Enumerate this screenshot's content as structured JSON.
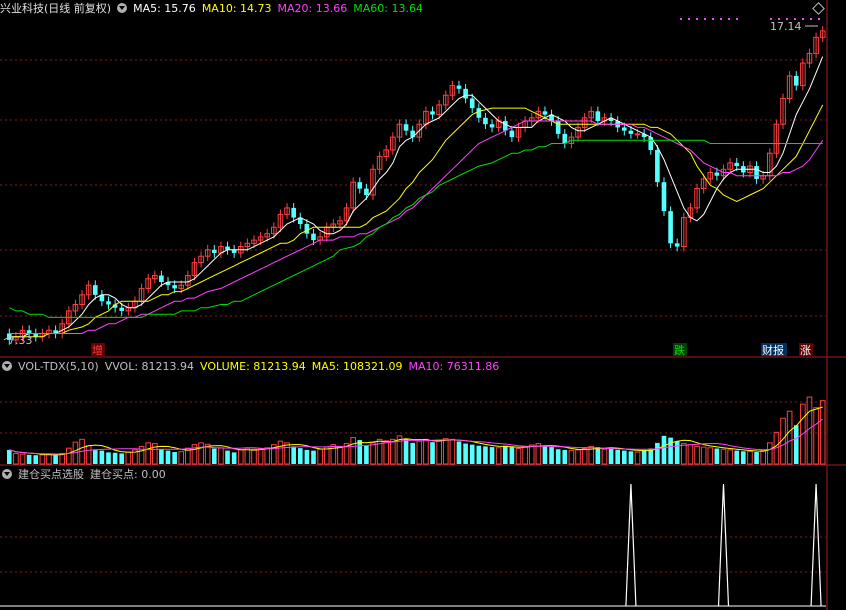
{
  "main_header": {
    "title": "兴业科技(日线 前复权)",
    "ma5": "MA5: 15.76",
    "ma10": "MA10: 14.73",
    "ma20": "MA20: 13.66",
    "ma60": "MA60: 13.64"
  },
  "vol_header": {
    "name": "VOL-TDX(5,10)",
    "vvol": "VVOL: 81213.94",
    "volume": "VOLUME: 81213.94",
    "ma5": "MA5: 108321.09",
    "ma10": "MA10: 76311.86"
  },
  "ind_header": {
    "name": "建仓买点选股",
    "value": "建仓买点: 0.00"
  },
  "annotations": {
    "high": "17.14",
    "low": "7.33",
    "tag_zeng": "增",
    "tag_die": "跌",
    "tag_caibao": "财报",
    "tag_zhang": "涨"
  },
  "colors": {
    "up": "#ff4040",
    "down": "#54ffff",
    "ma5": "#ffffff",
    "ma10": "#ffff00",
    "ma20": "#ff40ff",
    "ma60": "#00e000",
    "grid": "#8b1a1a"
  },
  "chart_data": [
    {
      "type": "candlestick",
      "title": "兴业科技(日线 前复权)",
      "ylim": [
        7.0,
        17.5
      ],
      "x": [
        "1",
        "2",
        "3",
        "4",
        "5",
        "6",
        "7",
        "8",
        "9",
        "10",
        "11",
        "12",
        "13",
        "14",
        "15",
        "16",
        "17",
        "18",
        "19",
        "20",
        "21",
        "22",
        "23",
        "24",
        "25",
        "26",
        "27",
        "28",
        "29",
        "30",
        "31",
        "32",
        "33",
        "34",
        "35",
        "36",
        "37",
        "38",
        "39",
        "40",
        "41",
        "42",
        "43",
        "44",
        "45",
        "46",
        "47",
        "48",
        "49",
        "50",
        "51",
        "52",
        "53",
        "54",
        "55",
        "56",
        "57",
        "58",
        "59",
        "60",
        "61",
        "62",
        "63",
        "64",
        "65",
        "66",
        "67",
        "68",
        "69",
        "70",
        "71",
        "72",
        "73",
        "74",
        "75",
        "76",
        "77",
        "78",
        "79",
        "80",
        "81",
        "82",
        "83",
        "84",
        "85",
        "86",
        "87",
        "88",
        "89",
        "90",
        "91",
        "92",
        "93",
        "94",
        "95",
        "96",
        "97",
        "98",
        "99",
        "100",
        "101",
        "102",
        "103",
        "104",
        "105",
        "106",
        "107",
        "108",
        "109",
        "110",
        "111",
        "112",
        "113",
        "114",
        "115",
        "116",
        "117",
        "118",
        "119",
        "120",
        "121",
        "122",
        "123",
        "124",
        "125",
        "126",
        "127",
        "128",
        "129",
        "130",
        "131",
        "132",
        "133",
        "134",
        "135",
        "136",
        "137",
        "138",
        "139",
        "140",
        "141",
        "142",
        "143",
        "144",
        "145",
        "146",
        "147",
        "148",
        "149",
        "150",
        "151",
        "152",
        "153",
        "154",
        "155",
        "156",
        "157",
        "158",
        "159",
        "160",
        "161",
        "162",
        "163",
        "164"
      ],
      "open": [
        7.7,
        7.5,
        7.6,
        7.8,
        7.7,
        7.6,
        7.7,
        7.8,
        7.7,
        8.0,
        8.4,
        8.6,
        8.9,
        9.2,
        8.9,
        8.7,
        8.6,
        8.5,
        8.4,
        8.5,
        8.7,
        9.1,
        9.4,
        9.5,
        9.3,
        9.2,
        9.1,
        9.2,
        9.5,
        9.9,
        10.1,
        10.3,
        10.2,
        10.4,
        10.3,
        10.2,
        10.4,
        10.5,
        10.6,
        10.7,
        10.8,
        11.0,
        11.4,
        11.6,
        11.3,
        11.1,
        10.8,
        10.6,
        10.7,
        11.0,
        11.1,
        11.2,
        11.6,
        12.4,
        12.2,
        12.0,
        12.8,
        13.2,
        13.4,
        13.8,
        14.2,
        14.0,
        13.8,
        14.2,
        14.6,
        14.5,
        14.8,
        15.1,
        15.4,
        15.3,
        15.0,
        14.7,
        14.4,
        14.2,
        14.1,
        14.3,
        14.0,
        13.8,
        14.1,
        14.3,
        14.4,
        14.6,
        14.5,
        14.3,
        13.9,
        13.6,
        13.8,
        14.1,
        14.4,
        14.6,
        14.3,
        14.4,
        14.3,
        14.1,
        14.0,
        13.9,
        13.9,
        13.8,
        13.4,
        12.4,
        11.5,
        10.5,
        10.4,
        11.3,
        11.6,
        12.2,
        12.5,
        12.7,
        12.6,
        12.8,
        13.0,
        12.9,
        12.7,
        12.9,
        12.5,
        12.6,
        13.3,
        14.2,
        15.0,
        15.7,
        15.4,
        16.1,
        16.4,
        16.9
      ],
      "close": [
        7.5,
        7.6,
        7.8,
        7.7,
        7.6,
        7.7,
        7.8,
        7.7,
        8.0,
        8.4,
        8.6,
        8.9,
        9.2,
        8.9,
        8.7,
        8.6,
        8.5,
        8.4,
        8.5,
        8.7,
        9.1,
        9.4,
        9.5,
        9.3,
        9.2,
        9.1,
        9.2,
        9.5,
        9.9,
        10.1,
        10.3,
        10.2,
        10.4,
        10.3,
        10.2,
        10.4,
        10.5,
        10.6,
        10.7,
        10.8,
        11.0,
        11.4,
        11.6,
        11.3,
        11.1,
        10.8,
        10.6,
        10.7,
        11.0,
        11.1,
        11.2,
        11.6,
        12.4,
        12.2,
        12.0,
        12.8,
        13.2,
        13.4,
        13.8,
        14.2,
        14.0,
        13.8,
        14.2,
        14.6,
        14.5,
        14.8,
        15.1,
        15.4,
        15.3,
        15.0,
        14.7,
        14.4,
        14.2,
        14.1,
        14.3,
        14.0,
        13.8,
        14.1,
        14.3,
        14.4,
        14.6,
        14.5,
        14.3,
        13.9,
        13.6,
        13.8,
        14.1,
        14.4,
        14.6,
        14.3,
        14.4,
        14.3,
        14.1,
        14.0,
        13.9,
        13.9,
        13.8,
        13.4,
        12.4,
        11.5,
        10.5,
        10.4,
        11.3,
        11.6,
        12.2,
        12.5,
        12.7,
        12.6,
        12.8,
        13.0,
        12.9,
        12.7,
        12.9,
        12.5,
        12.6,
        13.3,
        14.2,
        15.0,
        15.7,
        15.4,
        16.1,
        16.4,
        16.9,
        17.1
      ],
      "ma_series": [
        {
          "name": "MA5",
          "values": [
            7.6,
            7.6,
            7.6,
            7.7,
            7.7,
            7.7,
            7.7,
            7.7,
            7.8,
            7.9,
            8.1,
            8.3,
            8.6,
            8.8,
            8.9,
            8.9,
            8.8,
            8.6,
            8.5,
            8.5,
            8.6,
            8.8,
            9.0,
            9.2,
            9.3,
            9.3,
            9.3,
            9.3,
            9.4,
            9.6,
            9.8,
            10.0,
            10.2,
            10.3,
            10.3,
            10.3,
            10.3,
            10.4,
            10.5,
            10.6,
            10.7,
            10.9,
            11.1,
            11.2,
            11.3,
            11.2,
            11.1,
            10.9,
            10.8,
            10.8,
            10.9,
            11.1,
            11.5,
            11.7,
            11.9,
            12.2,
            12.5,
            12.7,
            13.0,
            13.5,
            13.7,
            13.8,
            14.0,
            14.2,
            14.3,
            14.4,
            14.6,
            14.8,
            15.0,
            15.1,
            15.1,
            14.9,
            14.7,
            14.5,
            14.3,
            14.2,
            14.1,
            14.1,
            14.1,
            14.1,
            14.3,
            14.4,
            14.5,
            14.4,
            14.3,
            14.1,
            14.0,
            14.0,
            14.1,
            14.2,
            14.3,
            14.4,
            14.3,
            14.2,
            14.1,
            14.0,
            13.9,
            13.8,
            13.5,
            13.1,
            12.6,
            12.1,
            11.6,
            11.3,
            11.2,
            11.4,
            11.8,
            12.2,
            12.5,
            12.7,
            12.8,
            12.8,
            12.8,
            12.8,
            12.7,
            12.7,
            12.9,
            13.3,
            13.9,
            14.5,
            14.9,
            15.3,
            15.8,
            16.3
          ]
        },
        {
          "name": "MA10",
          "values": [
            7.6,
            7.6,
            7.6,
            7.6,
            7.6,
            7.6,
            7.7,
            7.7,
            7.7,
            7.8,
            7.9,
            8.0,
            8.2,
            8.3,
            8.4,
            8.6,
            8.7,
            8.7,
            8.7,
            8.7,
            8.7,
            8.8,
            8.9,
            8.9,
            9.0,
            9.0,
            9.1,
            9.2,
            9.3,
            9.4,
            9.6,
            9.7,
            9.8,
            9.9,
            10.0,
            10.1,
            10.2,
            10.3,
            10.4,
            10.5,
            10.5,
            10.6,
            10.8,
            10.9,
            11.0,
            11.0,
            11.0,
            11.0,
            11.0,
            11.0,
            11.0,
            11.1,
            11.3,
            11.4,
            11.5,
            11.7,
            11.9,
            12.2,
            12.4,
            12.7,
            12.9,
            13.1,
            13.4,
            13.7,
            13.9,
            14.1,
            14.3,
            14.5,
            14.6,
            14.7,
            14.7,
            14.7,
            14.7,
            14.7,
            14.7,
            14.6,
            14.5,
            14.4,
            14.3,
            14.2,
            14.2,
            14.2,
            14.2,
            14.2,
            14.2,
            14.2,
            14.2,
            14.2,
            14.2,
            14.2,
            14.2,
            14.2,
            14.1,
            14.1,
            14.0,
            13.9,
            13.7,
            13.5,
            13.3,
            12.9,
            12.6,
            12.3,
            12.2,
            12.0,
            11.9,
            11.8,
            11.9,
            12.0,
            12.2,
            12.4,
            12.6,
            12.8,
            13.0,
            13.2,
            13.6,
            14.0,
            14.4,
            14.8
          ]
        },
        {
          "name": "MA20",
          "values": [
            7.7,
            7.7,
            7.7,
            7.7,
            7.7,
            7.7,
            7.7,
            7.7,
            7.7,
            7.7,
            7.7,
            7.8,
            7.8,
            7.9,
            8.0,
            8.0,
            8.1,
            8.2,
            8.2,
            8.3,
            8.3,
            8.4,
            8.5,
            8.6,
            8.7,
            8.7,
            8.8,
            8.8,
            8.9,
            9.0,
            9.1,
            9.2,
            9.3,
            9.4,
            9.5,
            9.6,
            9.7,
            9.8,
            9.9,
            10.0,
            10.1,
            10.2,
            10.3,
            10.4,
            10.5,
            10.6,
            10.6,
            10.6,
            10.7,
            10.7,
            10.8,
            10.8,
            10.9,
            11.0,
            11.1,
            11.2,
            11.3,
            11.5,
            11.6,
            11.8,
            12.0,
            12.2,
            12.4,
            12.6,
            12.8,
            13.0,
            13.2,
            13.4,
            13.6,
            13.8,
            13.9,
            14.0,
            14.1,
            14.2,
            14.3,
            14.3,
            14.3,
            14.3,
            14.3,
            14.3,
            14.3,
            14.3,
            14.3,
            14.3,
            14.3,
            14.2,
            14.2,
            14.2,
            14.2,
            14.2,
            14.1,
            14.1,
            14.0,
            13.9,
            13.8,
            13.7,
            13.6,
            13.5,
            13.4,
            13.2,
            13.0,
            12.9,
            12.8,
            12.7,
            12.7,
            12.6,
            12.6,
            12.6,
            12.6,
            12.6,
            12.6,
            12.7,
            12.7,
            12.8,
            12.9,
            13.1,
            13.4,
            13.7
          ]
        },
        {
          "name": "MA60",
          "values": [
            8.5,
            8.4,
            8.4,
            8.3,
            8.3,
            8.3,
            8.2,
            8.2,
            8.2,
            8.2,
            8.2,
            8.2,
            8.2,
            8.2,
            8.2,
            8.2,
            8.2,
            8.2,
            8.2,
            8.2,
            8.3,
            8.3,
            8.3,
            8.3,
            8.3,
            8.4,
            8.4,
            8.4,
            8.5,
            8.5,
            8.6,
            8.6,
            8.7,
            8.7,
            8.8,
            8.9,
            9.0,
            9.1,
            9.2,
            9.3,
            9.4,
            9.5,
            9.6,
            9.7,
            9.8,
            9.9,
            10.0,
            10.1,
            10.3,
            10.4,
            10.5,
            10.7,
            10.8,
            11.0,
            11.1,
            11.3,
            11.4,
            11.6,
            11.7,
            11.9,
            12.0,
            12.1,
            12.3,
            12.4,
            12.5,
            12.6,
            12.7,
            12.8,
            12.9,
            13.0,
            13.1,
            13.2,
            13.3,
            13.3,
            13.4,
            13.4,
            13.5,
            13.5,
            13.6,
            13.6,
            13.6,
            13.7,
            13.7,
            13.7,
            13.7,
            13.7,
            13.7,
            13.7,
            13.7,
            13.7,
            13.7,
            13.7,
            13.7,
            13.7,
            13.7,
            13.7,
            13.7,
            13.7,
            13.7,
            13.7,
            13.7,
            13.6,
            13.6,
            13.6,
            13.6,
            13.6,
            13.6,
            13.6,
            13.6,
            13.6,
            13.6,
            13.6,
            13.6,
            13.6,
            13.6,
            13.6,
            13.6,
            13.6
          ]
        }
      ]
    },
    {
      "type": "bar",
      "title": "VOL-TDX(5,10)",
      "ylim": [
        0,
        250000
      ],
      "values": [
        40000,
        30000,
        28000,
        26000,
        25000,
        26000,
        27000,
        25000,
        30000,
        45000,
        62000,
        70000,
        52000,
        40000,
        38000,
        33000,
        32000,
        30000,
        34000,
        40000,
        50000,
        60000,
        58000,
        42000,
        38000,
        34000,
        35000,
        45000,
        55000,
        60000,
        56000,
        44000,
        46000,
        38000,
        33000,
        40000,
        45000,
        42000,
        44000,
        46000,
        55000,
        65000,
        60000,
        50000,
        45000,
        40000,
        38000,
        42000,
        48000,
        55000,
        50000,
        58000,
        75000,
        68000,
        52000,
        60000,
        70000,
        66000,
        70000,
        80000,
        72000,
        60000,
        65000,
        70000,
        62000,
        68000,
        72000,
        70000,
        64000,
        58000,
        55000,
        52000,
        50000,
        48000,
        46000,
        52000,
        48000,
        44000,
        50000,
        54000,
        58000,
        52000,
        48000,
        42000,
        40000,
        38000,
        40000,
        44000,
        50000,
        48000,
        42000,
        46000,
        40000,
        38000,
        36000,
        34000,
        40000,
        44000,
        60000,
        80000,
        75000,
        65000,
        58000,
        55000,
        50000,
        48000,
        46000,
        44000,
        42000,
        40000,
        38000,
        36000,
        36000,
        34000,
        38000,
        60000,
        90000,
        130000,
        150000,
        110000,
        170000,
        190000,
        160000,
        180000
      ],
      "series": [
        {
          "name": "MA5",
          "values": []
        },
        {
          "name": "MA10",
          "values": []
        }
      ]
    },
    {
      "type": "line",
      "title": "建仓买点选股",
      "spikes_at": [
        94,
        108,
        122
      ],
      "ylim": [
        0,
        1
      ]
    }
  ]
}
